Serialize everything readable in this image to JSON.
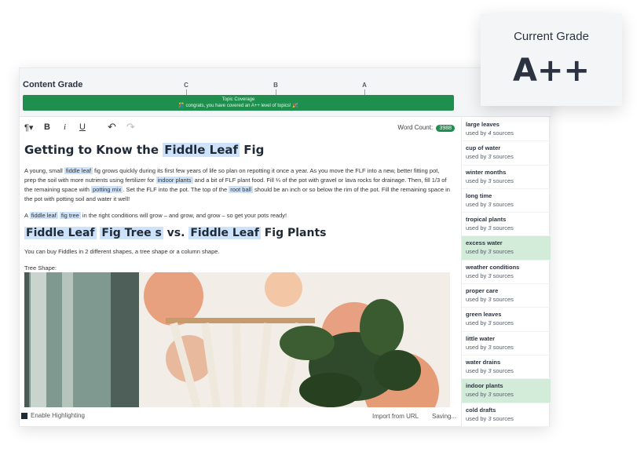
{
  "grade": {
    "title": "Content Grade",
    "ticks": [
      "C",
      "B",
      "A"
    ],
    "bar_title": "Topic Coverage",
    "bar_message": "🎊 congrats, you have covered an A++ level of topics! 🎉"
  },
  "current_grade": {
    "label": "Current Grade",
    "value": "A++"
  },
  "toolbar": {
    "paragraph": "¶▾",
    "bold": "B",
    "italic": "i",
    "underline": "U",
    "undo": "↶",
    "redo": "↷",
    "word_count_label": "Word Count:",
    "word_count": "3988"
  },
  "editor": {
    "h1_a": "Getting to Know the ",
    "h1_hl": "Fiddle Leaf",
    "h1_b": " Fig",
    "p1": [
      "A young, small ",
      "fiddle leaf",
      " fig grows quickly during its first few years of life so plan on repotting it once a year. As you move the FLF into a new, better fitting pot, prep the soil with more nutrients using fertilizer for ",
      "indoor plants",
      " and a bit of FLF plant food. Fill ¼ of the pot with gravel or lava rocks for drainage. Then, fill 1/3 of the remaining space with ",
      "potting mix",
      ". Set the FLF into the pot. The top of the ",
      "root ball",
      " should be an inch or so below the rim of the pot. Fill the remaining space in the pot with potting soil and water it well!"
    ],
    "p2": [
      "A ",
      "fiddle leaf",
      " ",
      "fig tree",
      " in the right conditions will grow – and grow, and grow – so get your pots ready!"
    ],
    "h2": [
      "Fiddle Leaf",
      "Fig Tree s",
      "vs.",
      "Fiddle Leaf",
      "Fig Plants"
    ],
    "p3": "You can buy Fiddles in 2 different shapes, a tree shape or a column shape.",
    "p4": "Tree Shape:"
  },
  "footer": {
    "enable_highlighting": "Enable Highlighting",
    "import": "Import from URL",
    "saving": "Saving..."
  },
  "topics": [
    {
      "name": "large leaves",
      "count": "4",
      "active": false
    },
    {
      "name": "cup of water",
      "count": "3",
      "active": false
    },
    {
      "name": "winter months",
      "count": "3",
      "active": false
    },
    {
      "name": "long time",
      "count": "3",
      "active": false
    },
    {
      "name": "tropical plants",
      "count": "3",
      "active": false
    },
    {
      "name": "excess water",
      "count": "3",
      "active": true
    },
    {
      "name": "weather conditions",
      "count": "3",
      "active": false
    },
    {
      "name": "proper care",
      "count": "3",
      "active": false
    },
    {
      "name": "green leaves",
      "count": "3",
      "active": false
    },
    {
      "name": "little water",
      "count": "3",
      "active": false
    },
    {
      "name": "water drains",
      "count": "3",
      "active": false
    },
    {
      "name": "indoor plants",
      "count": "3",
      "active": true
    },
    {
      "name": "cold drafts",
      "count": "3",
      "active": false
    }
  ],
  "topic_used_prefix": "used by ",
  "topic_used_suffix": " sources",
  "colors": {
    "accent_green": "#1f8f4e",
    "highlight_blue": "#cde3fb",
    "active_topic": "#d3ecd9"
  }
}
